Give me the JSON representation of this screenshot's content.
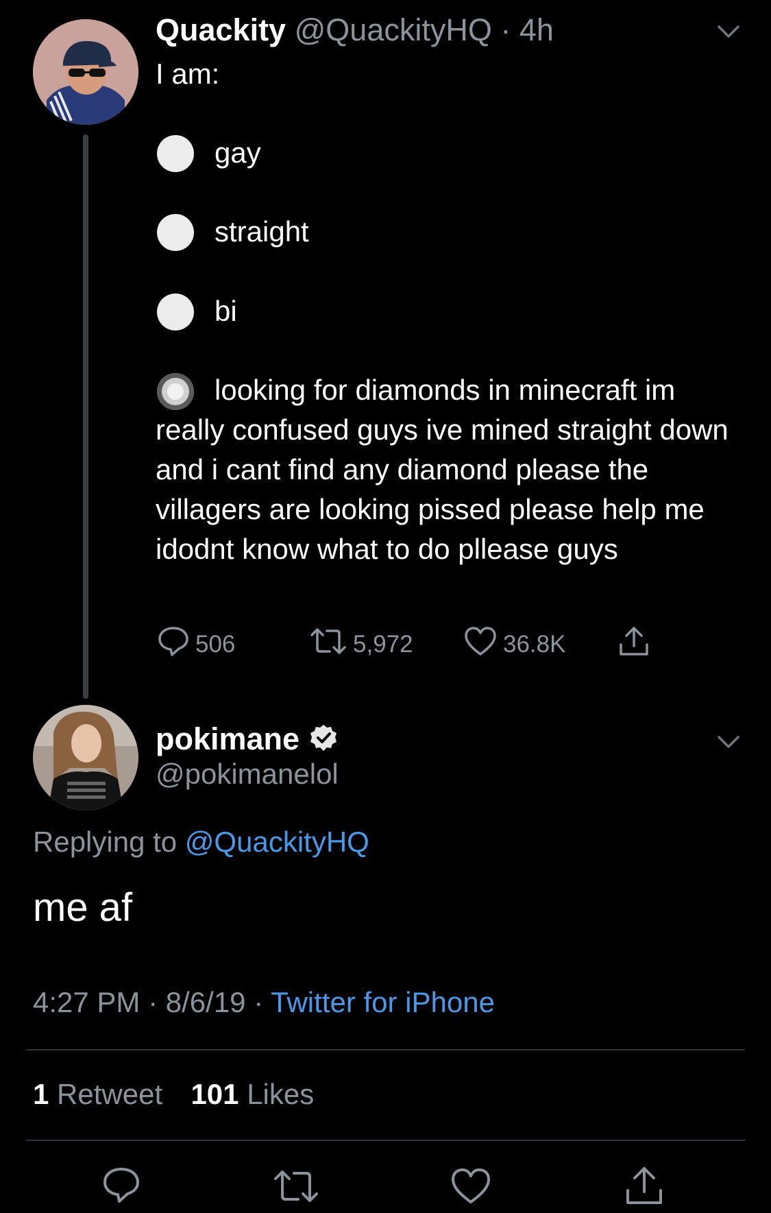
{
  "original_tweet": {
    "display_name": "Quackity",
    "handle": "@QuackityHQ",
    "separator": "·",
    "time_ago": "4h",
    "text": "I am:",
    "options": [
      {
        "label": "gay",
        "selected": false
      },
      {
        "label": "straight",
        "selected": false
      },
      {
        "label": "bi",
        "selected": false
      },
      {
        "label": "looking for diamonds in minecraft im really confused guys ive mined straight down and i cant find any diamond please the villagers are looking pissed please help me idodnt know what to do pllease guys",
        "selected": true
      }
    ],
    "actions": {
      "replies": "506",
      "retweets": "5,972",
      "likes": "36.8K"
    }
  },
  "reply_tweet": {
    "display_name": "pokimane",
    "verified": true,
    "handle": "@pokimanelol",
    "replying_to_label": "Replying to",
    "replying_to_handle": "@QuackityHQ",
    "text": "me af",
    "time": "4:27 PM",
    "date": "8/6/19",
    "separator": "·",
    "source": "Twitter for iPhone",
    "retweet_count": "1",
    "retweet_label": "Retweet",
    "like_count": "101",
    "like_label": "Likes"
  },
  "icons": [
    "chevron-down-icon",
    "reply-icon",
    "retweet-icon",
    "like-icon",
    "share-icon",
    "verified-badge-icon"
  ],
  "colors": {
    "background": "#000000",
    "text": "#ffffff",
    "secondary": "#8b939c",
    "link": "#4a99e9"
  }
}
